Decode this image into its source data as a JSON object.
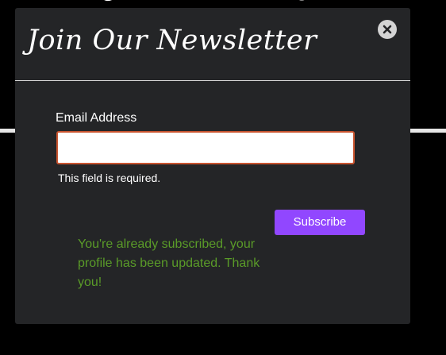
{
  "page": {
    "background_color": "#000000"
  },
  "modal": {
    "title": "Join Our Newsletter",
    "background_color": "#242527",
    "close_icon": "close-icon"
  },
  "form": {
    "email_label": "Email Address",
    "email_value": "",
    "email_placeholder": "",
    "error_text": "This field is required.",
    "error_border_color": "#c9542f",
    "subscribe_label": "Subscribe",
    "subscribe_color": "#9147ff"
  },
  "status": {
    "message": "You're already subscribed, your profile has been updated. Thank you!",
    "color": "#5a9b28"
  }
}
